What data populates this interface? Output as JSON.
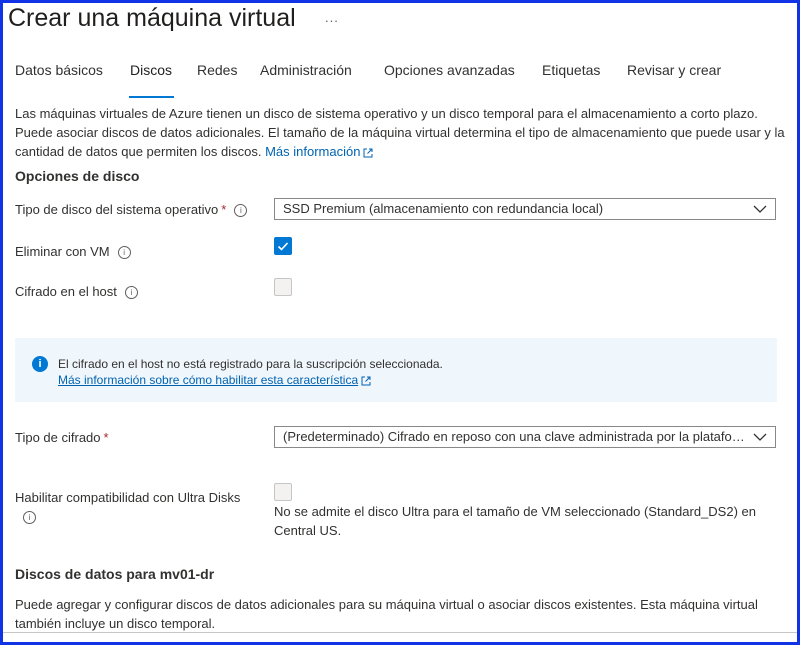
{
  "header": {
    "title": "Crear una máquina virtual",
    "more_label": "..."
  },
  "tabs": [
    {
      "label": "Datos básicos",
      "active": false
    },
    {
      "label": "Discos",
      "active": true
    },
    {
      "label": "Redes",
      "active": false
    },
    {
      "label": "Administración",
      "active": false
    },
    {
      "label": "Opciones avanzadas",
      "active": false
    },
    {
      "label": "Etiquetas",
      "active": false
    },
    {
      "label": "Revisar y crear",
      "active": false
    }
  ],
  "intro": {
    "text": "Las máquinas virtuales de Azure tienen un disco de sistema operativo y un disco temporal para el almacenamiento a corto plazo. Puede asociar discos de datos adicionales. El tamaño de la máquina virtual determina el tipo de almacenamiento que puede usar y la cantidad de datos que permiten los discos.",
    "link": "Más información"
  },
  "disk_options": {
    "section_title": "Opciones de disco",
    "os_disk_type_label": "Tipo de disco del sistema operativo",
    "os_disk_type_value": "SSD Premium (almacenamiento con redundancia local)",
    "delete_with_vm_label": "Eliminar con VM",
    "delete_with_vm_checked": true,
    "host_encryption_label": "Cifrado en el host",
    "host_encryption_checked": false
  },
  "banner": {
    "text": "El cifrado en el host no está registrado para la suscripción seleccionada.",
    "link": "Más información sobre cómo habilitar esta característica"
  },
  "encryption": {
    "label": "Tipo de cifrado",
    "value": "(Predeterminado) Cifrado en reposo con una clave administrada por la plataforma"
  },
  "ultra": {
    "label": "Habilitar compatibilidad con Ultra Disks",
    "checked": false,
    "note": "No se admite el disco Ultra para el tamaño de VM seleccionado (Standard_DS2) en Central US."
  },
  "data_disks": {
    "title": "Discos de datos para mv01-dr",
    "text": "Puede agregar y configurar discos de datos adicionales para su máquina virtual o asociar discos existentes. Esta máquina virtual también incluye un disco temporal."
  },
  "required_mark": "*",
  "info_glyph": "i",
  "colors": {
    "accent": "#0078d4",
    "link": "#0063b1",
    "frame": "#1033e6",
    "banner_bg": "#eff6fc",
    "required": "#a4262c"
  }
}
